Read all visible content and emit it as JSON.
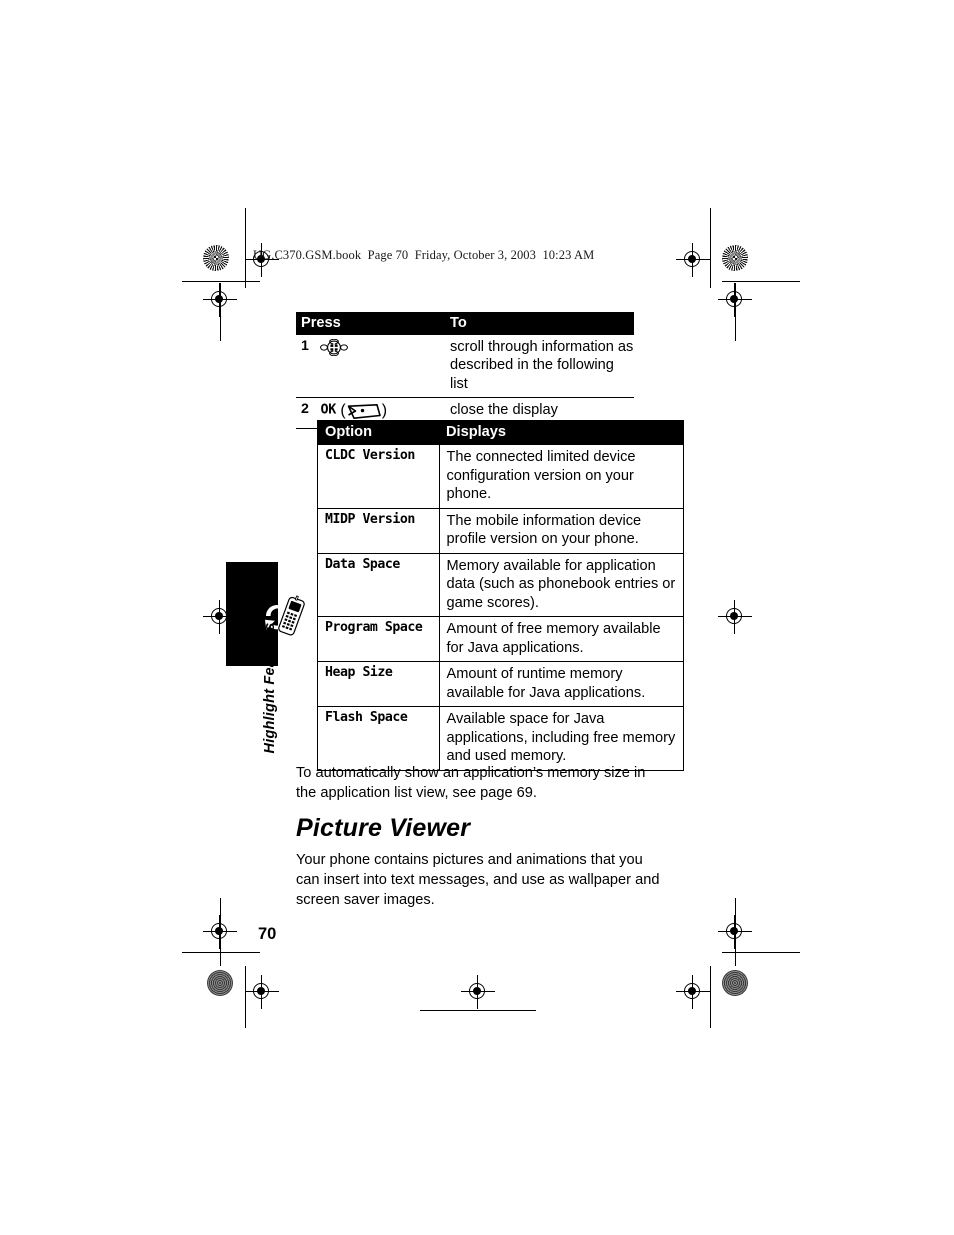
{
  "document": {
    "running_header": "UG.C370.GSM.book  Page 70  Friday, October 3, 2003  10:23 AM",
    "page_number": "70",
    "side_tab_label": "Highlight Features",
    "side_tab_icon": "phone-sync-icon"
  },
  "steps_table": {
    "headers": {
      "press": "Press",
      "to": "To"
    },
    "rows": [
      {
        "number": "1",
        "key_label": "",
        "key_icon": "navigation-key-icon",
        "to": "scroll through information as described in the following list"
      },
      {
        "number": "2",
        "key_label": "OK",
        "key_icon": "softkey-icon",
        "to": "close the display"
      }
    ]
  },
  "options_table": {
    "headers": {
      "option": "Option",
      "displays": "Displays"
    },
    "rows": [
      {
        "option": "CLDC Version",
        "displays": "The connected limited device configuration version on your phone."
      },
      {
        "option": "MIDP Version",
        "displays": "The mobile information device profile version on your phone."
      },
      {
        "option": "Data Space",
        "displays": "Memory available for application data (such as phonebook entries or game scores)."
      },
      {
        "option": "Program Space",
        "displays": "Amount of free memory available for Java applications."
      },
      {
        "option": "Heap Size",
        "displays": "Amount of runtime memory available for Java applications."
      },
      {
        "option": "Flash Space",
        "displays": "Available space for Java applications, including free memory and used memory."
      }
    ]
  },
  "prose": {
    "note": "To automatically show an application’s memory size in the application list view, see page 69.",
    "section_heading": "Picture Viewer",
    "section_body": "Your phone contains pictures and animations that you can insert into text messages, and use as wallpaper and screen saver images."
  },
  "colors": {
    "header_bar": "#000000",
    "header_text": "#ffffff",
    "body_text": "#000000",
    "page_background": "#ffffff"
  }
}
